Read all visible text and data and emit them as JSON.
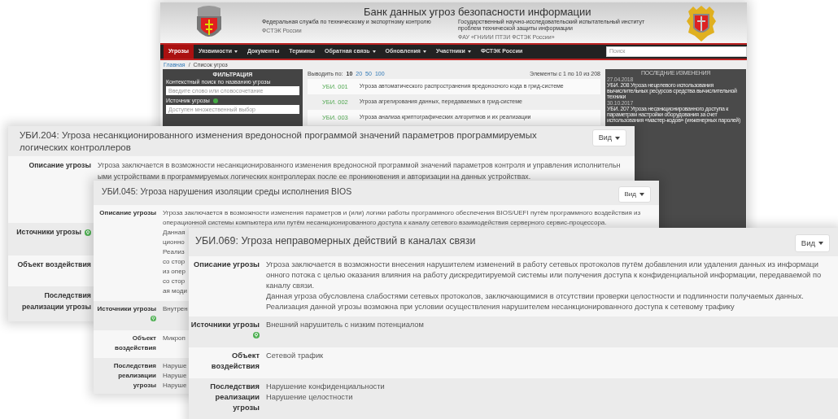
{
  "site": {
    "title": "Банк данных угроз безопасности информации",
    "org_left": {
      "name": "Федеральная служба по техническому и экспортному контролю",
      "short": "ФСТЭК России"
    },
    "org_right": {
      "name": "Государственный научно-исследовательский испытательный институт проблем технической защиты информации",
      "short": "ФАУ «ГНИИИ ПТЗИ ФСТЭК России»"
    },
    "nav": [
      {
        "label": "Угрозы",
        "selected": true,
        "dropdown": false
      },
      {
        "label": "Уязвимости",
        "selected": false,
        "dropdown": true
      },
      {
        "label": "Документы",
        "selected": false,
        "dropdown": false
      },
      {
        "label": "Термины",
        "selected": false,
        "dropdown": false
      },
      {
        "label": "Обратная связь",
        "selected": false,
        "dropdown": true
      },
      {
        "label": "Обновления",
        "selected": false,
        "dropdown": true
      },
      {
        "label": "Участники",
        "selected": false,
        "dropdown": true
      },
      {
        "label": "ФСТЭК России",
        "selected": false,
        "dropdown": false
      }
    ],
    "search": {
      "placeholder": "Поиск"
    },
    "breadcrumb": [
      "Главная",
      "Список угроз"
    ],
    "breadcrumb_separator": "/",
    "filter": {
      "title": "ФИЛЬТРАЦИЯ",
      "search_label": "Контекстный поиск по названию угрозы",
      "search_placeholder": "Введите слово или словосочетание",
      "source_label": "Источник угрозы",
      "source_placeholder": "Доступен множественный выбор"
    },
    "page_size": {
      "label": "Выводить по:",
      "options": [
        {
          "label": "10",
          "selected": true
        },
        {
          "label": "20",
          "selected": false
        },
        {
          "label": "50",
          "selected": false
        },
        {
          "label": "100",
          "selected": false
        }
      ]
    },
    "counter": "Элементы с 1 по 10 из 208",
    "threats": [
      {
        "code": "УБИ. 001",
        "name": "Угроза автоматического распространения вредоносного кода в грид-системе"
      },
      {
        "code": "УБИ. 002",
        "name": "Угроза агрегирования данных, передаваемых в грид-системе"
      },
      {
        "code": "УБИ. 003",
        "name": "Угроза анализа криптографических алгоритмов и их реализации"
      }
    ],
    "changes": {
      "title": "ПОСЛЕДНИЕ ИЗМЕНЕНИЯ",
      "entries": [
        {
          "date": "27.04.2018",
          "text": "УБИ. 208 Угроза нецелевого использования вычислительных ресурсов средства вычислительной техники"
        },
        {
          "date": "30.10.2017",
          "text": "УБИ. 207 Угроза несанкционированного доступа к параметрам настройки оборудования за счет использования «мастер-кодов» (инженерных паролей)"
        }
      ]
    }
  },
  "cards": [
    {
      "title": "УБИ.204: Угроза несанкционированного изменения вредоносной программой значений параметров программируемых логических контроллеров",
      "button": "Вид",
      "rows": [
        {
          "label": "Описание угрозы",
          "help_icon": false,
          "lines": [
            "Угроза заключается в возможности несанкционированного изменения вредоносной программой значений параметров контроля и управления исполнительн",
            "ыми устройствами в программируемых логических контроллерах после ее проникновения и авторизации на данных устройствах."
          ]
        },
        {
          "label": "Источники угрозы",
          "help_icon": true,
          "lines": []
        },
        {
          "label": "Объект воздействия",
          "help_icon": false,
          "lines": []
        },
        {
          "label": "Последствия реализации угрозы",
          "help_icon": false,
          "lines": []
        }
      ]
    },
    {
      "title": "УБИ.045: Угроза нарушения изоляции среды исполнения BIOS",
      "button": "Вид",
      "rows": [
        {
          "label": "Описание угрозы",
          "help_icon": false,
          "lines": [
            "Угроза заключается в возможности изменения параметров и (или) логики работы программного обеспечения BIOS/UEFI путём программного воздействия из",
            "операционной системы компьютера или путём несанкционированного доступа к каналу сетевого взаимодействия серверного сервис-процессора.",
            "Данная",
            "ционно",
            "Реализ",
            "со стор",
            "из опер",
            "со стор",
            "ая моди"
          ]
        },
        {
          "label": "Источники угрозы",
          "help_icon": true,
          "lines": [
            "Внутрен"
          ]
        },
        {
          "label": "Объект воздействия",
          "help_icon": false,
          "lines": [
            "Микроп"
          ]
        },
        {
          "label": "Последствия реализации угрозы",
          "help_icon": false,
          "lines": [
            "Наруше",
            "Наруше",
            "Наруше"
          ]
        }
      ]
    },
    {
      "title": "УБИ.069: Угроза неправомерных действий в каналах связи",
      "button": "Вид",
      "rows": [
        {
          "label": "Описание угрозы",
          "help_icon": false,
          "lines": [
            "Угроза заключается в возможности внесения нарушителем изменений в работу сетевых протоколов путём добавления или удаления данных из информаци",
            "онного потока с целью оказания влияния на работу дискредитируемой системы или получения доступа к конфиденциальной информации, передаваемой по",
            "каналу связи.",
            "Данная угроза обусловлена слабостями сетевых протоколов, заключающимися в отсутствии проверки целостности и подлинности получаемых данных.",
            "Реализация данной угрозы возможна при условии осуществления нарушителем несанкционированного доступа к сетевому трафику"
          ]
        },
        {
          "label": "Источники угрозы",
          "help_icon": true,
          "lines": [
            "Внешний нарушитель с низким потенциалом"
          ]
        },
        {
          "label": "Объект воздействия",
          "help_icon": false,
          "lines": [
            "Сетевой трафик"
          ]
        },
        {
          "label": "Последствия реализации угрозы",
          "help_icon": false,
          "lines": [
            "Нарушение конфиденциальности",
            "Нарушение целостности"
          ]
        }
      ]
    }
  ]
}
